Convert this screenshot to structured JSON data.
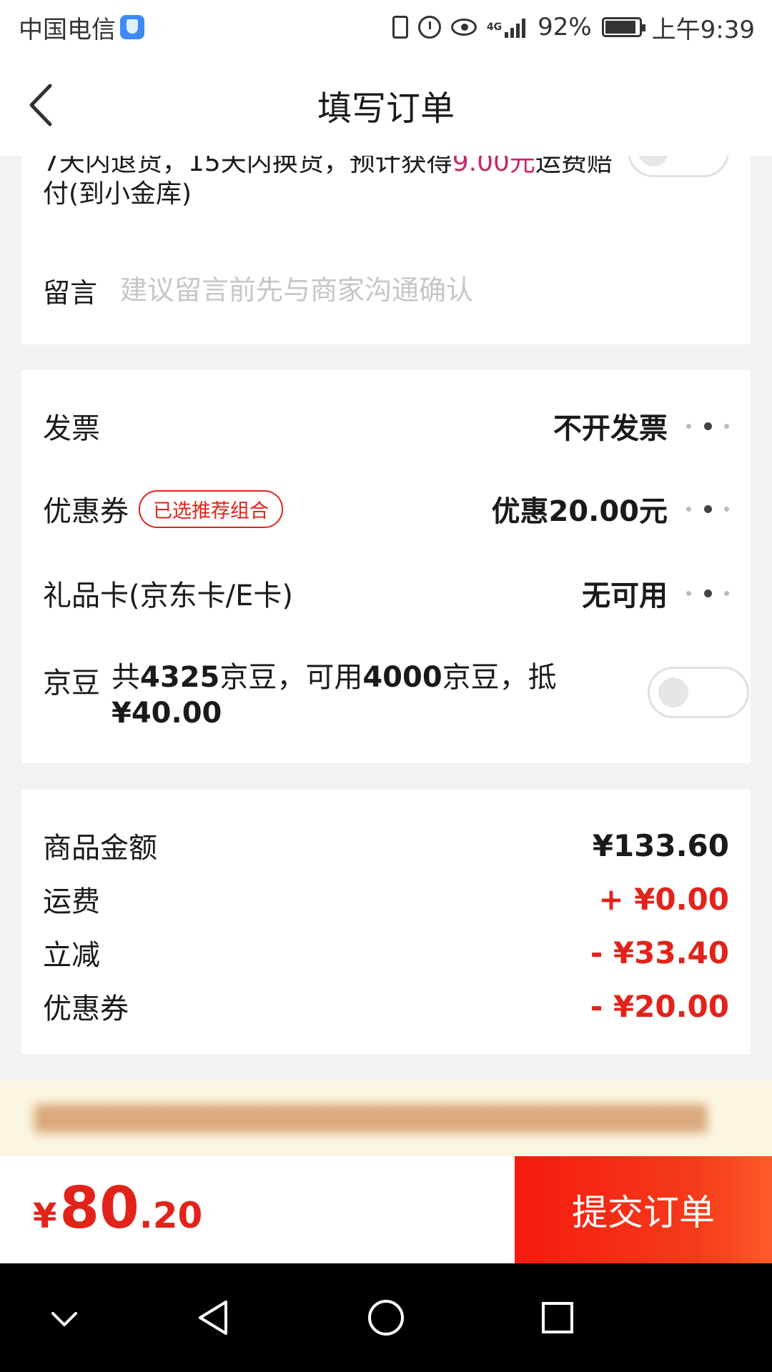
{
  "status_bar": {
    "carrier": "中国电信",
    "network": "4G",
    "battery": "92%",
    "time": "上午9:39"
  },
  "nav": {
    "title": "填写订单"
  },
  "returns": {
    "text_before": "7天内退货，15天内换货，预计获得",
    "highlight": "9.00元",
    "text_after": "运费赔付(到小金库)",
    "enabled": false
  },
  "message": {
    "label": "留言",
    "placeholder": "建议留言前先与商家沟通确认",
    "value": ""
  },
  "options": {
    "invoice": {
      "label": "发票",
      "value": "不开发票"
    },
    "coupon": {
      "label": "优惠券",
      "tag": "已选推荐组合",
      "value": "优惠20.00元"
    },
    "gift_card": {
      "label": "礼品卡(京东卡/E卡)",
      "value": "无可用"
    },
    "beans": {
      "label": "京豆",
      "text_1": "共",
      "total": "4325",
      "text_2": "京豆，可用",
      "usable": "4000",
      "text_3": "京豆，抵",
      "deduct": "¥40.00",
      "enabled": false
    }
  },
  "summary": {
    "goods": {
      "label": "商品金额",
      "value": "¥133.60"
    },
    "shipping": {
      "label": "运费",
      "value": "+ ¥0.00"
    },
    "discount": {
      "label": "立减",
      "value": "- ¥33.40"
    },
    "coupon": {
      "label": "优惠券",
      "value": "- ¥20.00"
    }
  },
  "checkout": {
    "symbol": "¥",
    "integer": "80",
    "decimal": ".20",
    "submit": "提交订单"
  },
  "colors": {
    "accent_red": "#e2231a",
    "highlight_pink": "#c8266a",
    "notice_bg": "#fbf6e1"
  }
}
